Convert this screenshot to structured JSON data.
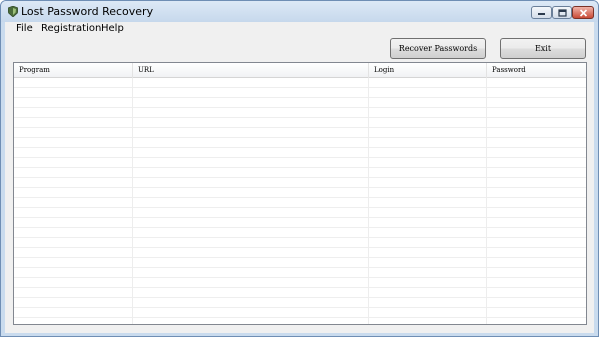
{
  "window": {
    "title": "Lost Password Recovery",
    "icon": "shield-app-icon",
    "controls": {
      "minimize": "minimize-icon",
      "maximize": "maximize-icon",
      "close": "close-icon"
    }
  },
  "menu": {
    "items": [
      {
        "label": "File"
      },
      {
        "label": "Registration"
      },
      {
        "label": "Help"
      }
    ]
  },
  "toolbar": {
    "recover_label": "Recover Passwords",
    "exit_label": "Exit"
  },
  "table": {
    "columns": [
      {
        "label": "Program"
      },
      {
        "label": "URL"
      },
      {
        "label": "Login"
      },
      {
        "label": "Password"
      }
    ],
    "rows": []
  }
}
